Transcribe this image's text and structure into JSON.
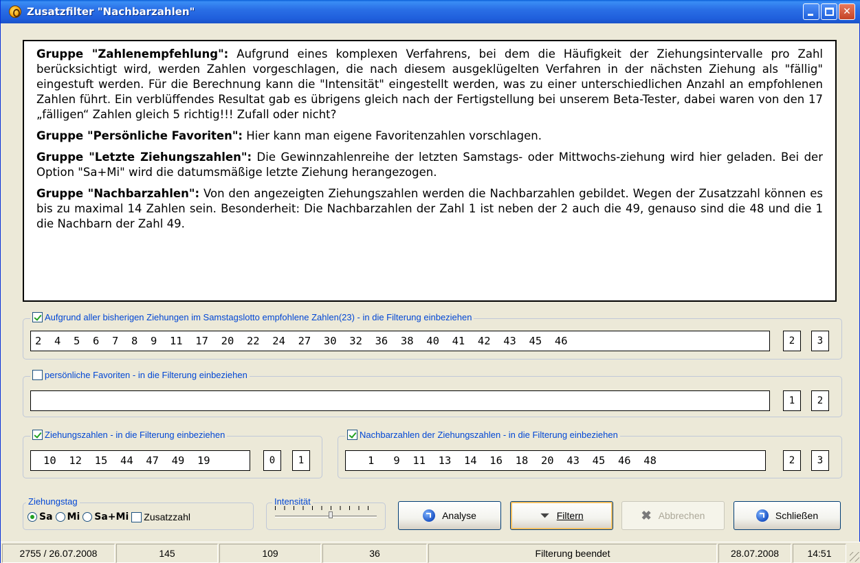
{
  "window": {
    "title": "Zusatzfilter \"Nachbarzahlen\""
  },
  "info": {
    "p1_heading": "Gruppe \"Zahlenempfehlung\":",
    "p1_text": " Aufgrund eines komplexen Verfahrens, bei dem die Häufigkeit der Ziehungsintervalle pro Zahl berücksichtigt wird, werden Zahlen vorgeschlagen, die nach diesem ausgeklügelten Verfahren in der nächsten Ziehung als \"fällig\" eingestuft werden. Für die Berechnung kann die \"Intensität\" eingestellt werden, was zu einer unterschiedlichen Anzahl an empfohlenen Zahlen führt. Ein verblüffendes Resultat gab es übrigens gleich nach der Fertigstellung bei unserem Beta-Tester, dabei waren von den 17 „fälligen“ Zahlen gleich 5 richtig!!!  Zufall oder nicht?",
    "p2_heading": "Gruppe \"Persönliche Favoriten\":",
    "p2_text": " Hier kann man eigene Favoritenzahlen vorschlagen.",
    "p3_heading": "Gruppe \"Letzte Ziehungszahlen\":",
    "p3_text": " Die Gewinnzahlenreihe der letzten Samstags- oder Mittwochs-ziehung wird hier geladen. Bei der Option \"Sa+Mi\" wird die datumsmäßige letzte Ziehung herangezogen.",
    "p4_heading": "Gruppe \"Nachbarzahlen\":",
    "p4_text": " Von den angezeigten Ziehungszahlen werden die Nachbarzahlen gebildet. Wegen der Zusatzzahl können es bis zu maximal 14 Zahlen sein. Besonderheit: Die Nachbarzahlen der Zahl 1 ist neben der 2 auch die 49, genauso sind die 48 und die 1 die Nachbarn der Zahl 49."
  },
  "recommend": {
    "checked": true,
    "label": "Aufgrund aller bisherigen Ziehungen im Samstagslotto empfohlene Zahlen(23) - in die Filterung einbeziehen",
    "numbers": "2  4  5  6  7  8  9  11  17  20  22  24  27  30  32  36  38  40  41  42  43  45  46",
    "box1": "2",
    "box2": "3"
  },
  "favorites": {
    "checked": false,
    "label": "persönliche Favoriten  - in die Filterung einbeziehen",
    "numbers": "",
    "box1": "1",
    "box2": "2"
  },
  "draw": {
    "checked": true,
    "label": "Ziehungszahlen - in die Filterung einbeziehen",
    "numbers": "10  12  15  44  47  49  19",
    "box1": "0",
    "box2": "1"
  },
  "neighbors": {
    "checked": true,
    "label": "Nachbarzahlen der Ziehungszahlen - in die Filterung einbeziehen",
    "numbers": "1   9  11  13  14  16  18  20  43  45  46  48",
    "box1": "2",
    "box2": "3"
  },
  "drawday": {
    "label": "Ziehungstag",
    "options": [
      "Sa",
      "Mi",
      "Sa+Mi"
    ],
    "selected": "Sa",
    "extra_label": "Zusatzzahl",
    "extra_checked": false
  },
  "intensity": {
    "label": "Intensität",
    "level": 0.55
  },
  "buttons": {
    "analyse": "Analyse",
    "filter": "Filtern",
    "cancel": "Abbrechen",
    "close": "Schließen"
  },
  "status": {
    "draw_date": "2755 / 26.07.2008",
    "c1": "145",
    "c2": "109",
    "c3": "36",
    "message": "Filterung beendet",
    "date": "28.07.2008",
    "time": "14:51"
  }
}
